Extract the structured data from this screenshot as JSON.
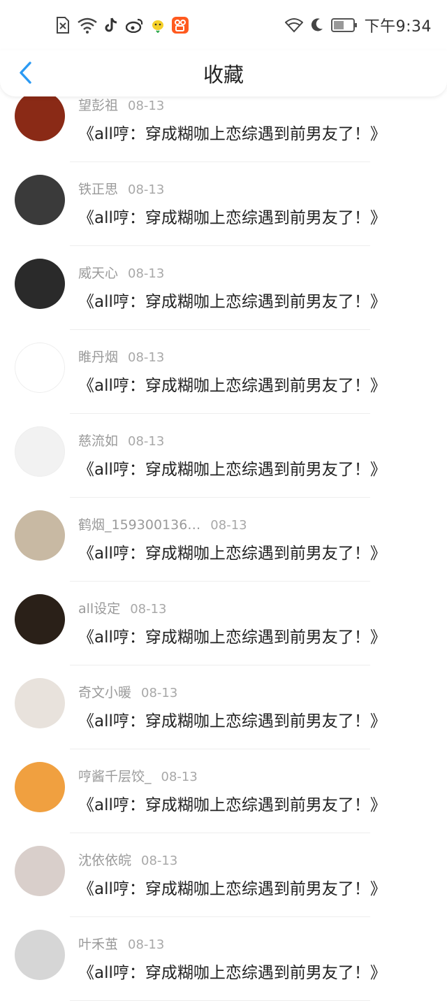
{
  "status_bar": {
    "time": "下午9:34",
    "left_icons": [
      "sim-off-icon",
      "wifi-signal-icon",
      "tiktok-icon",
      "weibo-icon",
      "chick-app-icon",
      "kuaishou-icon"
    ],
    "right_icons": [
      "wifi-icon",
      "moon-icon",
      "battery-icon"
    ]
  },
  "header": {
    "title": "收藏",
    "back_icon": "chevron-left-icon",
    "accent_color": "#2b9af3"
  },
  "items": [
    {
      "name": "望彭祖",
      "date": "08-13",
      "title": "《all哼：穿成糊咖上恋综遇到前男友了！》",
      "avatar": "sunset-avatar",
      "avatar_color": "#8a2a16"
    },
    {
      "name": "铁正思",
      "date": "08-13",
      "title": "《all哼：穿成糊咖上恋综遇到前男友了！》",
      "avatar": "bw-figure-avatar",
      "avatar_color": "#3a3a3a"
    },
    {
      "name": "威天心",
      "date": "08-13",
      "title": "《all哼：穿成糊咖上恋综遇到前男友了！》",
      "avatar": "i-love-mustache-avatar",
      "avatar_color": "#2a2a2a"
    },
    {
      "name": "睢丹烟",
      "date": "08-13",
      "title": "《all哼：穿成糊咖上恋综遇到前男友了！》",
      "avatar": "kumamon-avatar",
      "avatar_color": "#ffffff"
    },
    {
      "name": "慈流如",
      "date": "08-13",
      "title": "《all哼：穿成糊咖上恋综遇到前男友了！》",
      "avatar": "faded-avatar",
      "avatar_color": "#f2f2f2"
    },
    {
      "name": "鹤烟_159300136…",
      "date": "08-13",
      "title": "《all哼：穿成糊咖上恋综遇到前男友了！》",
      "avatar": "flowers-avatar",
      "avatar_color": "#c8b9a3"
    },
    {
      "name": "all设定",
      "date": "08-13",
      "title": "《all哼：穿成糊咖上恋综遇到前男友了！》",
      "avatar": "dusk-sun-avatar",
      "avatar_color": "#2a2018"
    },
    {
      "name": "奇文小暖",
      "date": "08-13",
      "title": "《all哼：穿成糊咖上恋综遇到前男友了！》",
      "avatar": "smiling-man-avatar",
      "avatar_color": "#e8e2dc"
    },
    {
      "name": "哼酱千层饺_",
      "date": "08-13",
      "title": "《all哼：穿成糊咖上恋综遇到前男友了！》",
      "avatar": "oranges-avatar",
      "avatar_color": "#f0a040"
    },
    {
      "name": "沈依依皖",
      "date": "08-13",
      "title": "《all哼：穿成糊咖上恋综遇到前男友了！》",
      "avatar": "girl-portrait-avatar",
      "avatar_color": "#d9cfcb"
    },
    {
      "name": "叶禾茧",
      "date": "08-13",
      "title": "《all哼：穿成糊咖上恋综遇到前男友了！》",
      "avatar": "anime-cat-avatar",
      "avatar_color": "#d6d6d6"
    }
  ]
}
